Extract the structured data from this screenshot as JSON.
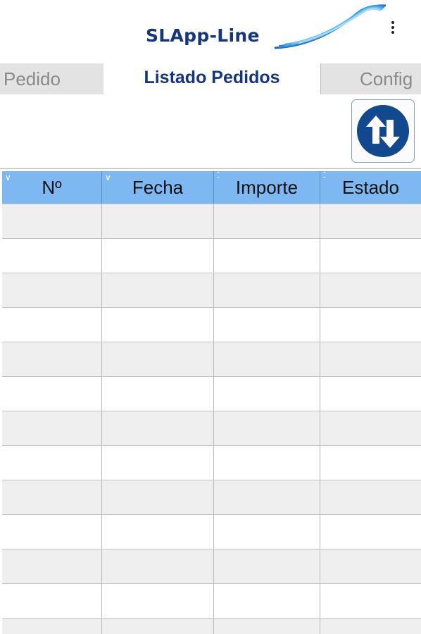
{
  "header": {
    "app_title": "SLApp-Line",
    "logo_icon": "swoosh-logo",
    "menu_icon": "overflow-menu-icon"
  },
  "tabs": [
    {
      "label": "Pedido",
      "active": false
    },
    {
      "label": "Listado Pedidos",
      "active": true
    },
    {
      "label": "Config",
      "active": false
    }
  ],
  "toolbar": {
    "sort_icon": "sort-up-down-icon"
  },
  "table": {
    "columns": [
      {
        "label": "Nº",
        "sort": "desc"
      },
      {
        "label": "Fecha",
        "sort": "desc"
      },
      {
        "label": "Importe",
        "sort": "none"
      },
      {
        "label": "Estado",
        "sort": "none"
      }
    ],
    "rows": [
      [
        "",
        "",
        "",
        ""
      ],
      [
        "",
        "",
        "",
        ""
      ],
      [
        "",
        "",
        "",
        ""
      ],
      [
        "",
        "",
        "",
        ""
      ],
      [
        "",
        "",
        "",
        ""
      ],
      [
        "",
        "",
        "",
        ""
      ],
      [
        "",
        "",
        "",
        ""
      ],
      [
        "",
        "",
        "",
        ""
      ],
      [
        "",
        "",
        "",
        ""
      ],
      [
        "",
        "",
        "",
        ""
      ],
      [
        "",
        "",
        "",
        ""
      ],
      [
        "",
        "",
        "",
        ""
      ],
      [
        "",
        "",
        "",
        ""
      ]
    ]
  },
  "colors": {
    "brand": "#15367a",
    "header_row": "#7db8f2",
    "inactive_tab": "#e3e3e3",
    "row_alt": "#efefef"
  }
}
